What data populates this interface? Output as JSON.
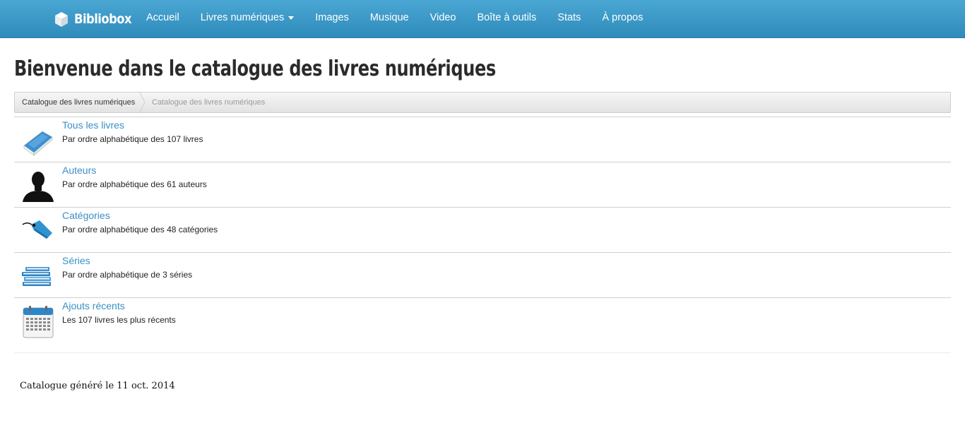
{
  "brand": {
    "name": "Bibliobox",
    "icon": "box-icon"
  },
  "nav": {
    "items": [
      {
        "label": "Accueil"
      },
      {
        "label": "Livres numériques",
        "dropdown": true
      },
      {
        "label": "Images"
      },
      {
        "label": "Musique"
      },
      {
        "label": "Video"
      },
      {
        "label": "Boîte à outils"
      },
      {
        "label": "Stats"
      },
      {
        "label": "À propos"
      }
    ]
  },
  "page": {
    "title": "Bienvenue dans le catalogue des livres numériques"
  },
  "breadcrumb": [
    {
      "label": "Catalogue des livres numériques"
    },
    {
      "label": "Catalogue des livres numériques"
    }
  ],
  "entries": [
    {
      "icon": "book-icon",
      "title": "Tous les livres",
      "description": "Par ordre alphabétique des 107 livres"
    },
    {
      "icon": "person-silhouette-icon",
      "title": "Auteurs",
      "description": "Par ordre alphabétique des 61 auteurs"
    },
    {
      "icon": "tag-icon",
      "title": "Catégories",
      "description": "Par ordre alphabétique des 48 catégories"
    },
    {
      "icon": "book-stack-icon",
      "title": "Séries",
      "description": "Par ordre alphabétique de 3 séries"
    },
    {
      "icon": "calendar-icon",
      "title": "Ajouts récents",
      "description": "Les 107 livres les plus récents"
    }
  ],
  "footer": {
    "text": "Catalogue généré le 11 oct. 2014"
  },
  "colors": {
    "navbar": "#3a97c7",
    "link": "#3a8fc6",
    "text": "#333333"
  }
}
